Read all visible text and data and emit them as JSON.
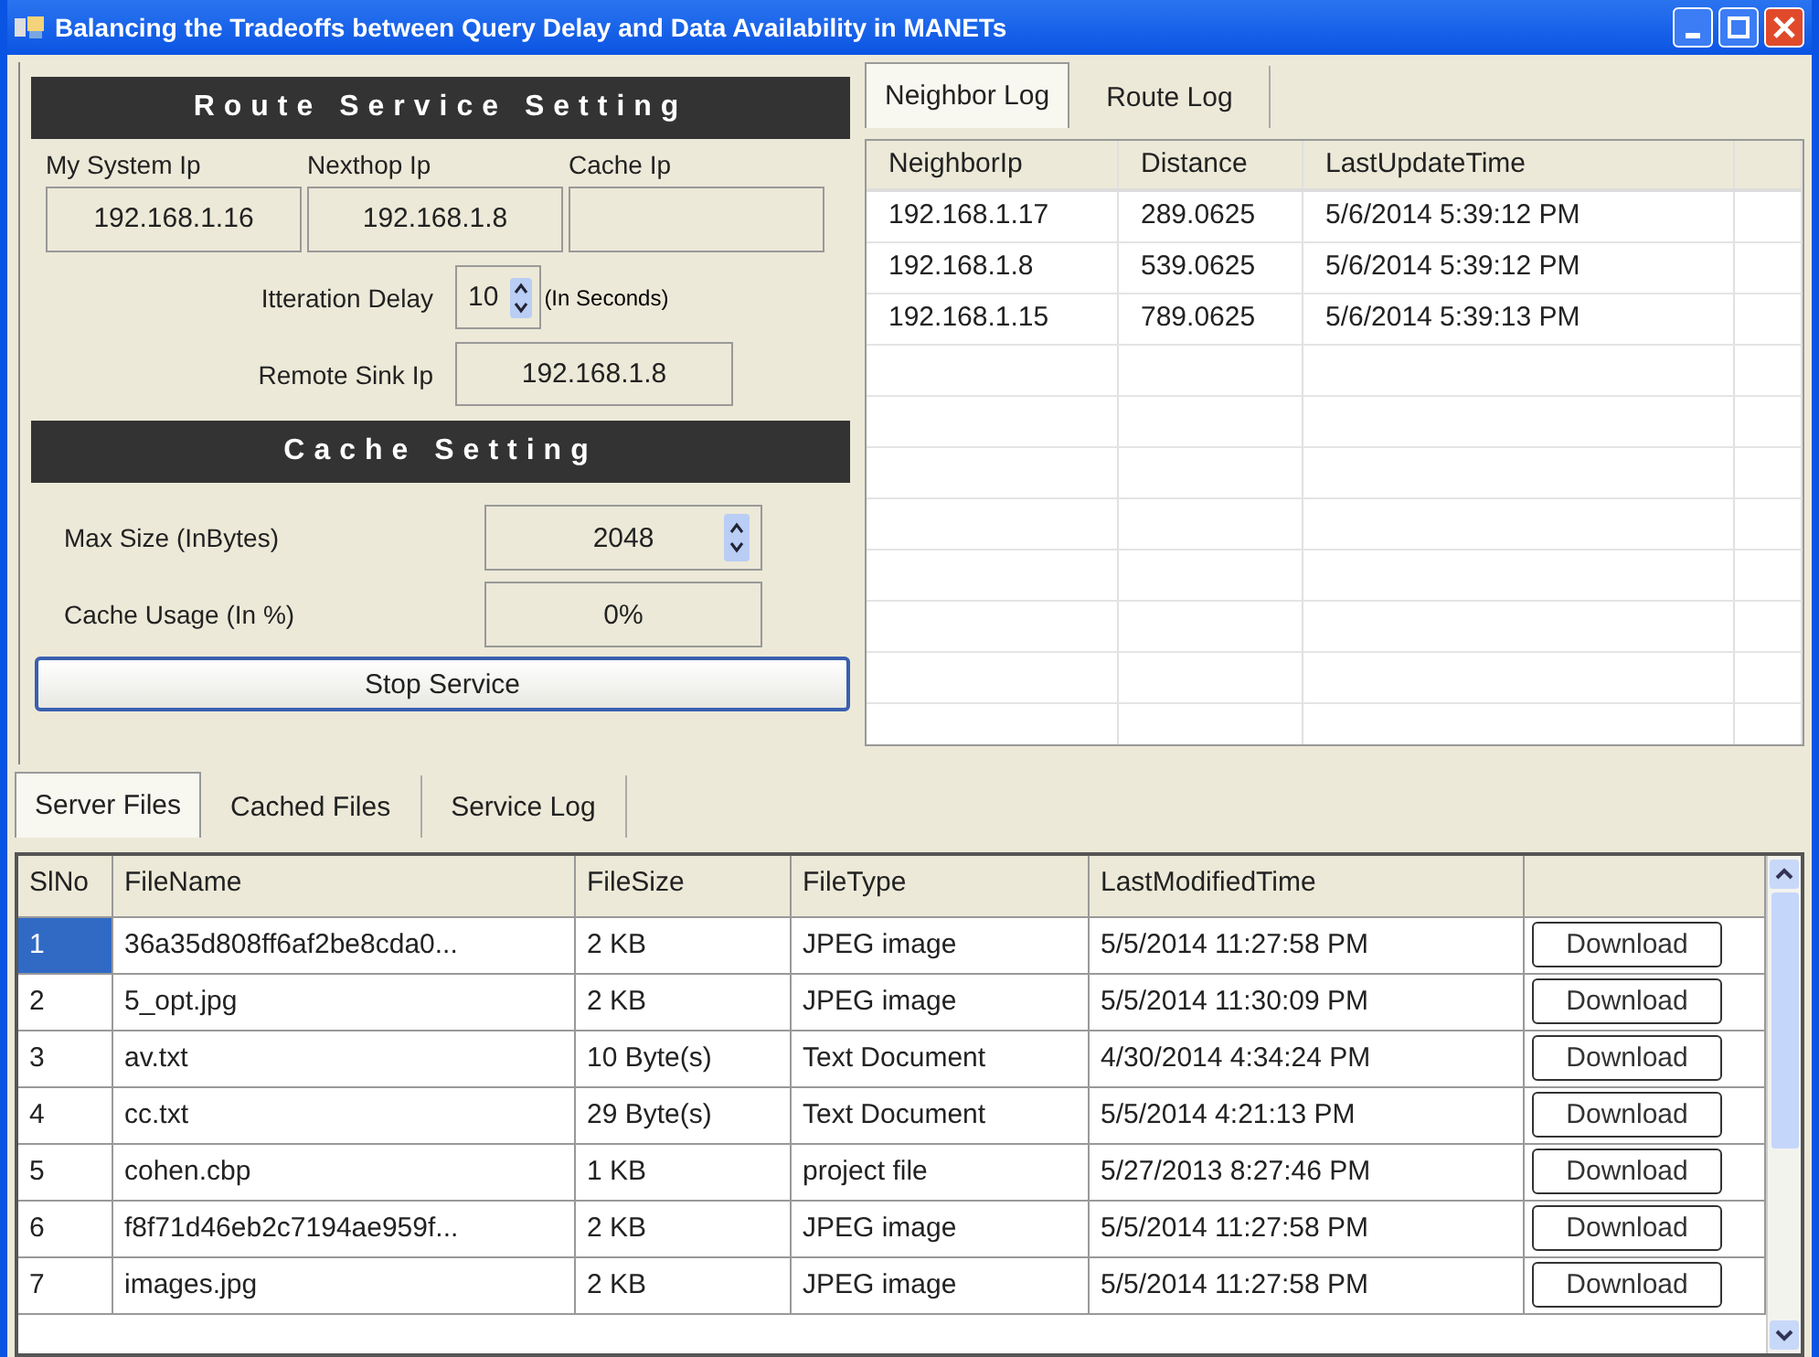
{
  "window": {
    "title": "Balancing the Tradeoffs between Query Delay and Data Availability in MANETs"
  },
  "route_service": {
    "header": "Route Service Setting",
    "ip_fields": [
      {
        "label": "My System Ip",
        "value": "192.168.1.16"
      },
      {
        "label": "Nexthop Ip",
        "value": "192.168.1.8"
      },
      {
        "label": "Cache Ip"
      }
    ],
    "iteration_delay": {
      "label": "Itteration Delay",
      "value": "10",
      "unit": "(In Seconds)"
    },
    "remote_sink": {
      "label": "Remote Sink Ip",
      "value": "192.168.1.8"
    }
  },
  "cache_setting": {
    "header": "Cache Setting",
    "max_size": {
      "label": "Max Size (InBytes)",
      "value": "2048"
    },
    "cache_usage": {
      "label": "Cache Usage (In %)",
      "value": "0%"
    }
  },
  "stop_button": "Stop Service",
  "log_tabs": [
    {
      "label": "Neighbor Log",
      "selected": true
    },
    {
      "label": "Route Log",
      "selected": false
    }
  ],
  "neighbor_table": {
    "columns": [
      "NeighborIp",
      "Distance",
      "LastUpdateTime"
    ],
    "rows": [
      [
        "192.168.1.17",
        "289.0625",
        "5/6/2014 5:39:12 PM"
      ],
      [
        "192.168.1.8",
        "539.0625",
        "5/6/2014 5:39:12 PM"
      ],
      [
        "192.168.1.15",
        "789.0625",
        "5/6/2014 5:39:13 PM"
      ]
    ]
  },
  "file_tabs": [
    {
      "label": "Server Files",
      "selected": true
    },
    {
      "label": "Cached Files",
      "selected": false
    },
    {
      "label": "Service Log",
      "selected": false
    }
  ],
  "files_table": {
    "columns": [
      "SlNo",
      "FileName",
      "FileSize",
      "FileType",
      "LastModifiedTime"
    ],
    "rows": [
      {
        "cells": [
          "1",
          "36a35d808ff6af2be8cda0...",
          "2 KB",
          "JPEG image",
          "5/5/2014 11:27:58 PM"
        ],
        "action": "Download",
        "selected": true
      },
      {
        "cells": [
          "2",
          "5_opt.jpg",
          "2 KB",
          "JPEG image",
          "5/5/2014 11:30:09 PM"
        ],
        "action": "Download",
        "selected": false
      },
      {
        "cells": [
          "3",
          "av.txt",
          "10 Byte(s)",
          "Text Document",
          "4/30/2014 4:34:24 PM"
        ],
        "action": "Download",
        "selected": false
      },
      {
        "cells": [
          "4",
          "cc.txt",
          "29 Byte(s)",
          "Text Document",
          "5/5/2014 4:21:13 PM"
        ],
        "action": "Download",
        "selected": false
      },
      {
        "cells": [
          "5",
          "cohen.cbp",
          "1 KB",
          "project file",
          "5/27/2013 8:27:46 PM"
        ],
        "action": "Download",
        "selected": false
      },
      {
        "cells": [
          "6",
          "f8f71d46eb2c7194ae959f...",
          "2 KB",
          "JPEG image",
          "5/5/2014 11:27:58 PM"
        ],
        "action": "Download",
        "selected": false
      },
      {
        "cells": [
          "7",
          "images.jpg",
          "2 KB",
          "JPEG image",
          "5/5/2014 11:27:58 PM"
        ],
        "action": "Download",
        "selected": false
      }
    ]
  }
}
